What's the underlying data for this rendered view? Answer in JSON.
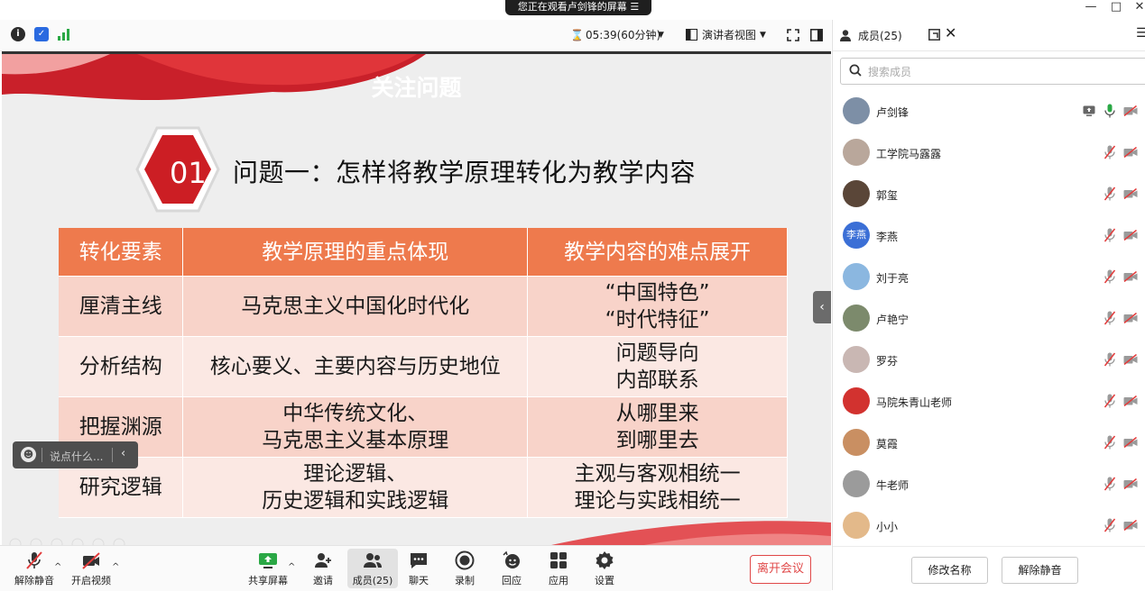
{
  "window": {
    "share_banner": "您正在观看卢剑锋的屏幕",
    "minimize": "—",
    "maximize": "□",
    "close": "✕"
  },
  "meeting_bar": {
    "timer": "05:39(60分钟)",
    "view_mode": "演讲者视图"
  },
  "slide": {
    "title": "关注问题",
    "number": "01",
    "question": "问题一：怎样将教学原理转化为教学内容",
    "table": {
      "headers": [
        "转化要素",
        "教学原理的重点体现",
        "教学内容的难点展开"
      ],
      "rows": [
        [
          "厘清主线",
          "马克思主义中国化时代化",
          "“中国特色”\n“时代特征”"
        ],
        [
          "分析结构",
          "核心要义、主要内容与历史地位",
          "问题导向\n内部联系"
        ],
        [
          "把握渊源",
          "中华传统文化、\n马克思主义基本原理",
          "从哪里来\n到哪里去"
        ],
        [
          "研究逻辑",
          "理论逻辑、\n历史逻辑和实践逻辑",
          "主观与客观相统一\n理论与实践相统一"
        ]
      ]
    }
  },
  "chat_box": {
    "placeholder": "说点什么..."
  },
  "controls": {
    "unmute": "解除静音",
    "start_video": "开启视频",
    "share_screen": "共享屏幕",
    "invite": "邀请",
    "members": "成员(25)",
    "chat": "聊天",
    "record": "录制",
    "reactions": "回应",
    "apps": "应用",
    "settings": "设置",
    "leave": "离开会议"
  },
  "panel": {
    "title": "成员(25)",
    "search_placeholder": "搜索成员",
    "members": [
      {
        "name": "卢剑锋",
        "avatar_color": "#7d8fa6",
        "mic_active": true,
        "sharing": true
      },
      {
        "name": "工学院马露露",
        "avatar_color": "#b9a79b",
        "mic_active": false,
        "sharing": false
      },
      {
        "name": "郭玺",
        "avatar_color": "#5a4638",
        "mic_active": false,
        "sharing": false
      },
      {
        "name": "李燕",
        "avatar_color": "#3b6fd6",
        "avatar_text": "李燕",
        "mic_active": false,
        "sharing": false
      },
      {
        "name": "刘于亮",
        "avatar_color": "#8bb7e0",
        "mic_active": false,
        "sharing": false
      },
      {
        "name": "卢艳宁",
        "avatar_color": "#7c8a6c",
        "mic_active": false,
        "sharing": false
      },
      {
        "name": "罗芬",
        "avatar_color": "#c9b7b3",
        "mic_active": false,
        "sharing": false
      },
      {
        "name": "马院朱青山老师",
        "avatar_color": "#d2322f",
        "mic_active": false,
        "sharing": false
      },
      {
        "name": "莫霞",
        "avatar_color": "#c98f62",
        "mic_active": false,
        "sharing": false
      },
      {
        "name": "牛老师",
        "avatar_color": "#9b9b9b",
        "mic_active": false,
        "sharing": false
      },
      {
        "name": "小小",
        "avatar_color": "#e3b98a",
        "mic_active": false,
        "sharing": false
      }
    ],
    "rename_button": "修改名称",
    "unmute_button": "解除静音"
  }
}
